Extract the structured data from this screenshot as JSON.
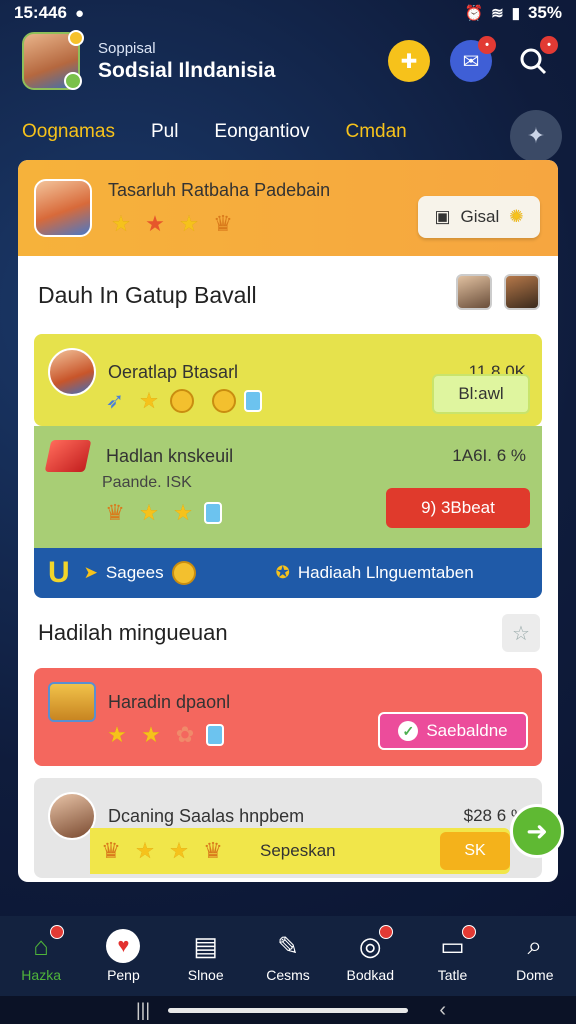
{
  "status_bar": {
    "time": "15:446",
    "battery": "35%"
  },
  "header": {
    "subtitle": "Soppisal",
    "title": "Sodsial Ilndanisia"
  },
  "tabs": [
    "Oognamas",
    "Pul",
    "Eongantiov",
    "Cmdan"
  ],
  "top_banner": {
    "title": "Tasarluh Ratbaha Padebain",
    "button_label": "Gisal"
  },
  "section_title": "Dauh In Gatup Bavall",
  "rows": [
    {
      "title": "Oeratlap Btasarl",
      "value": "11.8 0K",
      "button_label": "Bl:awl"
    },
    {
      "title": "Hadlan knskeuil",
      "subtitle": "Paande. ISK",
      "value": "1A6I. 6 %",
      "button_label": "9) 3Bbeat"
    }
  ],
  "blue_bar": {
    "label_left": "Sagees",
    "label_right": "Hadiaah Llnguemtaben"
  },
  "subsection_title": "Hadilah mingueuan",
  "pink_row": {
    "title": "Haradin dpaonl",
    "button_label": "Saebaldne"
  },
  "gray_row": {
    "title": "Dcaning Saalas hnpbem",
    "value": "$28 6 %",
    "bar_label": "Sepeskan",
    "orange_label": "SK"
  },
  "bottom_nav": [
    {
      "label": "Hazka",
      "icon": "home-icon"
    },
    {
      "label": "Penp",
      "icon": "heart-icon"
    },
    {
      "label": "Slnoe",
      "icon": "document-icon"
    },
    {
      "label": "Cesms",
      "icon": "pen-icon"
    },
    {
      "label": "Bodkad",
      "icon": "target-icon"
    },
    {
      "label": "Tatle",
      "icon": "tv-icon"
    },
    {
      "label": "Dome",
      "icon": "search-icon"
    }
  ],
  "colors": {
    "background": "#0f1c3c",
    "accent_yellow": "#f6c21b",
    "accent_green": "#4fb43a",
    "banner_orange": "#f6b23b",
    "row_yellow": "#e6e24c",
    "row_green": "#a8ce75",
    "row_blue": "#1f5aa8",
    "row_pink": "#f4675e"
  }
}
